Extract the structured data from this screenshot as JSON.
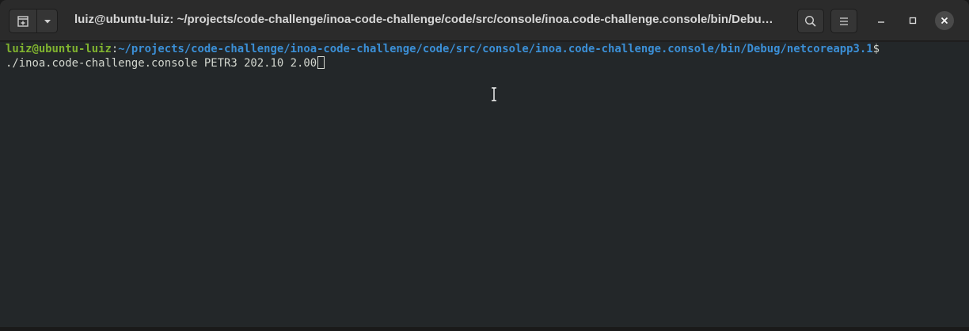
{
  "window": {
    "title": "luiz@ubuntu-luiz: ~/projects/code-challenge/inoa-code-challenge/code/src/console/inoa.code-challenge.console/bin/Debu…"
  },
  "icons": {
    "new_tab": "new-tab-icon",
    "tab_menu": "chevron-down-icon",
    "search": "search-icon",
    "menu": "hamburger-menu-icon",
    "minimize": "minimize-icon",
    "maximize": "maximize-icon",
    "close": "close-icon"
  },
  "terminal": {
    "prompt_user": "luiz@ubuntu-luiz",
    "prompt_colon": ":",
    "prompt_path": "~/projects/code-challenge/inoa-code-challenge/code/src/console/inoa.code-challenge.console/bin/Debug/netcoreapp3.1",
    "prompt_symbol": "$",
    "command": "./inoa.code-challenge.console PETR3 202.10 2.00"
  },
  "colors": {
    "terminal_bg": "#232729",
    "titlebar_bg": "#2b2b2b",
    "prompt_user": "#80b32f",
    "prompt_path": "#3b8fd6",
    "text": "#d3d7cf"
  }
}
